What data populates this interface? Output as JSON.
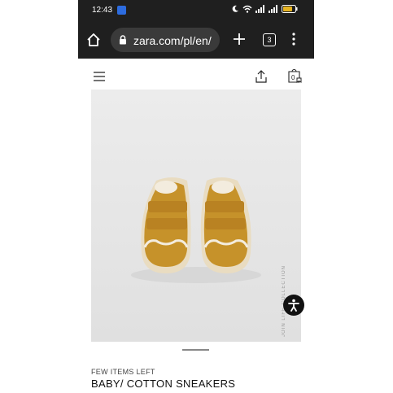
{
  "status_bar": {
    "time": "12:43",
    "icons": [
      "app-notification-icon",
      "moon-icon",
      "wifi-icon",
      "signal-icon",
      "signal-icon",
      "battery-icon"
    ]
  },
  "browser": {
    "url": "zara.com/pl/en/",
    "tab_count": "3",
    "icons": [
      "home-icon",
      "lock-icon",
      "plus-icon",
      "tabs-icon",
      "more-vert-icon"
    ]
  },
  "site_header": {
    "icons": [
      "hamburger-menu-icon",
      "share-icon",
      "shopping-bag-icon"
    ],
    "bag_count": "0"
  },
  "product": {
    "image_name": "product-image",
    "collection_label": "JOIN LIFE COLLECTION",
    "stock_label": "FEW ITEMS LEFT",
    "name": "BABY/ COTTON SNEAKERS"
  },
  "colors": {
    "status_bg": "#1f1f1f",
    "shoe_mustard": "#c6922a",
    "image_bg": "#e8e8e8"
  }
}
